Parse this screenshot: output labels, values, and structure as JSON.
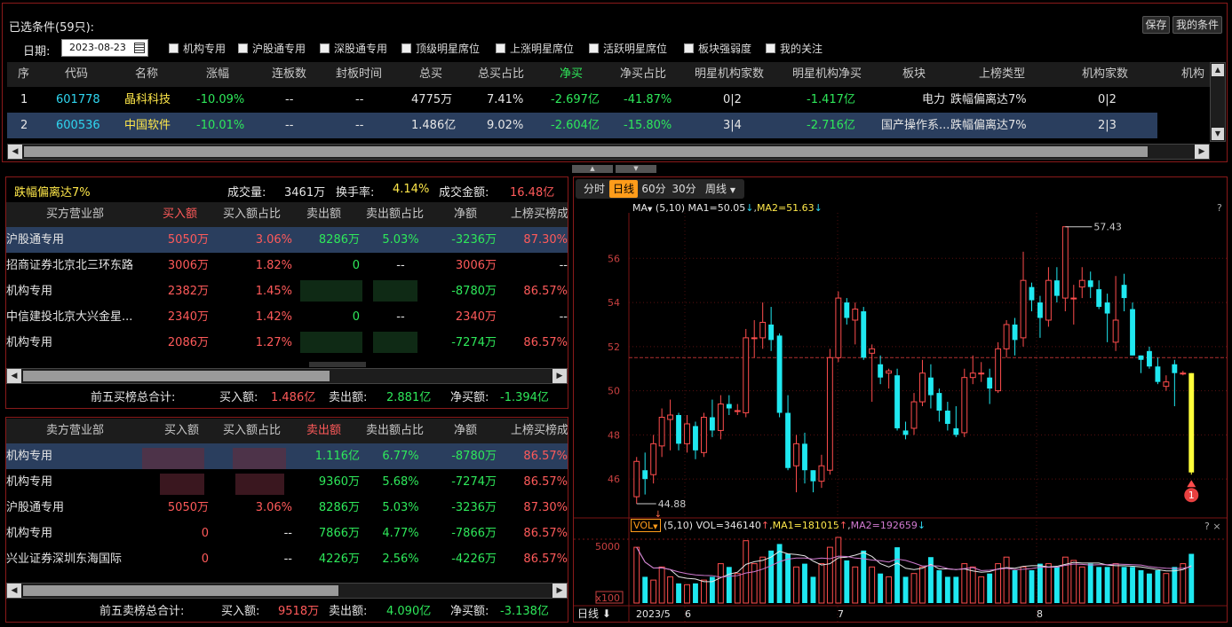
{
  "title": "已选条件(59只):",
  "buttons": {
    "save": "保存",
    "my_conditions": "我的条件"
  },
  "date_label": "日期:",
  "date_value": "2023-08-23",
  "filters": [
    "机构专用",
    "沪股通专用",
    "深股通专用",
    "顶级明星席位",
    "上涨明星席位",
    "活跃明星席位",
    "板块强弱度",
    "我的关注"
  ],
  "top_table": {
    "headers": [
      "序",
      "代码",
      "名称",
      "涨幅",
      "连板数",
      "封板时间",
      "总买",
      "总买占比",
      "净买",
      "净买占比",
      "明星机构家数",
      "明星机构净买",
      "板块",
      "上榜类型",
      "机构家数",
      "机构"
    ],
    "rows": [
      [
        "1",
        "601778",
        "晶科科技",
        "-10.09%",
        "--",
        "--",
        "4775万",
        "7.41%",
        "-2.697亿",
        "-41.87%",
        "0|2",
        "-1.417亿",
        "电力",
        "跌幅偏离达7%",
        "0|2"
      ],
      [
        "2",
        "600536",
        "中国软件",
        "-10.01%",
        "--",
        "--",
        "1.486亿",
        "9.02%",
        "-2.604亿",
        "-15.80%",
        "3|4",
        "-2.716亿",
        "国产操作系...",
        "跌幅偏离达7%",
        "2|3"
      ]
    ]
  },
  "summary": {
    "type": "跌幅偏离达7%",
    "vol_label": "成交量:",
    "vol": "3461万",
    "turn_label": "换手率:",
    "turn": "4.14%",
    "amt_label": "成交金额:",
    "amt": "16.48亿"
  },
  "buy_table": {
    "headers": [
      "买方营业部",
      "买入额",
      "买入额占比",
      "卖出额",
      "卖出额占比",
      "净额",
      "上榜买榜成"
    ],
    "rows": [
      [
        "沪股通专用",
        "5050万",
        "3.06%",
        "8286万",
        "5.03%",
        "-3236万",
        "87.30%"
      ],
      [
        "招商证券北京北三环东路",
        "3006万",
        "1.82%",
        "0",
        "--",
        "3006万",
        "--"
      ],
      [
        "机构专用",
        "2382万",
        "1.45%",
        "",
        "",
        "-8780万",
        "86.57%"
      ],
      [
        "中信建投北京大兴金星...",
        "2340万",
        "1.42%",
        "0",
        "--",
        "2340万",
        "--"
      ],
      [
        "机构专用",
        "2086万",
        "1.27%",
        "",
        "",
        "-7274万",
        "86.57%"
      ]
    ],
    "total": {
      "label": "前五买榜总合计:",
      "buy_label": "买入额:",
      "buy": "1.486亿",
      "sell_label": "卖出额:",
      "sell": "2.881亿",
      "net_label": "净买额:",
      "net": "-1.394亿"
    }
  },
  "sell_table": {
    "headers": [
      "卖方营业部",
      "买入额",
      "买入额占比",
      "卖出额",
      "卖出额占比",
      "净额",
      "上榜买榜成"
    ],
    "rows": [
      [
        "机构专用",
        "",
        "",
        "1.116亿",
        "6.77%",
        "-8780万",
        "86.57%"
      ],
      [
        "机构专用",
        "",
        "",
        "9360万",
        "5.68%",
        "-7274万",
        "86.57%"
      ],
      [
        "沪股通专用",
        "5050万",
        "3.06%",
        "8286万",
        "5.03%",
        "-3236万",
        "87.30%"
      ],
      [
        "机构专用",
        "0",
        "--",
        "7866万",
        "4.77%",
        "-7866万",
        "86.57%"
      ],
      [
        "兴业证券深圳东海国际",
        "0",
        "--",
        "4226万",
        "2.56%",
        "-4226万",
        "86.57%"
      ]
    ],
    "total": {
      "label": "前五卖榜总合计:",
      "buy_label": "买入额:",
      "buy": "9518万",
      "sell_label": "卖出额:",
      "sell": "4.090亿",
      "net_label": "净买额:",
      "net": "-3.138亿"
    }
  },
  "chart_tabs": [
    "分时",
    "日线",
    "60分",
    "30分",
    "周线"
  ],
  "ma_line": {
    "label": "MA",
    "params": "(5,10)",
    "ma1": "MA1=50.05",
    "ma2": "MA2=51.63"
  },
  "vol_line": {
    "label": "VOL",
    "params": "(5,10)",
    "vol": "VOL=346140",
    "ma1": "MA1=181015",
    "ma2": "MA2=192659"
  },
  "chart_data": {
    "type": "candlestick",
    "y_ticks": [
      46,
      48,
      50,
      52,
      54,
      56
    ],
    "ylim": [
      44.4,
      57.9
    ],
    "high_label": "57.43",
    "low_label": "44.88",
    "ref_price": 51.5,
    "x_labels": [
      "2023/5",
      "6",
      "7",
      "8"
    ],
    "vol_ticks": [
      "5000",
      "x100"
    ],
    "period_label": "日线",
    "marker": "1",
    "candles": [
      [
        45.2,
        46.8,
        44.88,
        47.0
      ],
      [
        46.4,
        46.0,
        45.3,
        47.2
      ],
      [
        46.2,
        47.6,
        45.8,
        48.0
      ],
      [
        47.5,
        48.8,
        47.0,
        49.2
      ],
      [
        48.7,
        48.9,
        47.3,
        49.6
      ],
      [
        48.9,
        47.6,
        47.3,
        49.0
      ],
      [
        47.6,
        48.5,
        47.2,
        48.9
      ],
      [
        48.4,
        47.3,
        46.9,
        48.6
      ],
      [
        47.2,
        48.8,
        47.0,
        49.0
      ],
      [
        48.8,
        48.2,
        47.9,
        49.6
      ],
      [
        48.2,
        49.4,
        47.8,
        49.8
      ],
      [
        49.4,
        49.2,
        48.9,
        49.8
      ],
      [
        49.1,
        49.1,
        48.9,
        49.4
      ],
      [
        49.0,
        52.4,
        48.8,
        52.8
      ],
      [
        52.4,
        52.4,
        51.5,
        53.2
      ],
      [
        52.4,
        53.1,
        51.9,
        54.0
      ],
      [
        53.0,
        52.3,
        51.8,
        53.8
      ],
      [
        52.5,
        49.0,
        48.8,
        52.6
      ],
      [
        49.0,
        46.5,
        46.4,
        49.8
      ],
      [
        46.6,
        47.6,
        45.4,
        48.0
      ],
      [
        47.6,
        46.4,
        45.8,
        48.1
      ],
      [
        46.4,
        45.9,
        45.4,
        46.4
      ],
      [
        45.9,
        46.6,
        45.6,
        47.1
      ],
      [
        46.4,
        51.5,
        46.2,
        51.9
      ],
      [
        51.5,
        54.2,
        51.3,
        54.5
      ],
      [
        54.0,
        53.3,
        53.0,
        54.2
      ],
      [
        53.2,
        53.7,
        52.1,
        54.0
      ],
      [
        53.6,
        51.5,
        51.4,
        53.8
      ],
      [
        51.7,
        51.9,
        49.5,
        52.1
      ],
      [
        51.2,
        50.6,
        50.3,
        51.6
      ],
      [
        50.8,
        50.9,
        50.1,
        51.0
      ],
      [
        50.7,
        48.3,
        48.2,
        51.0
      ],
      [
        48.2,
        48.0,
        47.8,
        48.6
      ],
      [
        48.3,
        49.5,
        48.0,
        49.9
      ],
      [
        49.5,
        50.8,
        49.3,
        51.4
      ],
      [
        50.6,
        49.8,
        49.2,
        51.2
      ],
      [
        49.9,
        49.1,
        48.6,
        50.1
      ],
      [
        49.1,
        48.5,
        48.2,
        49.5
      ],
      [
        48.3,
        48.0,
        47.9,
        49.3
      ],
      [
        48.1,
        50.6,
        47.9,
        51.0
      ],
      [
        50.6,
        50.8,
        50.3,
        51.6
      ],
      [
        50.8,
        50.8,
        50.4,
        51.3
      ],
      [
        50.6,
        50.1,
        49.4,
        51.0
      ],
      [
        50.0,
        51.9,
        49.9,
        52.2
      ],
      [
        51.9,
        53.0,
        51.5,
        53.2
      ],
      [
        53.0,
        52.3,
        51.6,
        53.3
      ],
      [
        52.4,
        55.0,
        52.0,
        56.3
      ],
      [
        54.7,
        54.1,
        53.6,
        54.9
      ],
      [
        54.0,
        53.3,
        52.4,
        54.3
      ],
      [
        53.2,
        55.0,
        52.9,
        55.6
      ],
      [
        55.0,
        54.3,
        54.0,
        55.6
      ],
      [
        54.2,
        57.43,
        53.6,
        57.43
      ],
      [
        54.2,
        54.2,
        53.0,
        54.8
      ],
      [
        54.7,
        55.0,
        54.2,
        55.6
      ],
      [
        55.0,
        54.7,
        54.2,
        55.4
      ],
      [
        54.6,
        53.8,
        53.7,
        55.0
      ],
      [
        54.0,
        53.5,
        52.2,
        54.4
      ],
      [
        52.2,
        53.2,
        51.8,
        55.2
      ],
      [
        54.8,
        54.2,
        53.6,
        55.3
      ],
      [
        53.7,
        51.6,
        51.6,
        54.0
      ],
      [
        51.6,
        51.4,
        50.8,
        51.6
      ],
      [
        51.8,
        51.1,
        51.0,
        52.0
      ],
      [
        51.1,
        50.4,
        50.3,
        51.5
      ],
      [
        50.2,
        50.4,
        50.0,
        50.7
      ],
      [
        51.2,
        50.8,
        49.3,
        51.4
      ],
      [
        50.8,
        50.8,
        50.7,
        50.9
      ],
      [
        50.8,
        46.3,
        46.2,
        50.8
      ]
    ],
    "volume": [
      85,
      40,
      35,
      55,
      40,
      30,
      28,
      30,
      35,
      40,
      60,
      55,
      45,
      95,
      60,
      70,
      80,
      90,
      75,
      55,
      60,
      40,
      60,
      85,
      100,
      65,
      55,
      80,
      55,
      45,
      40,
      85,
      40,
      45,
      55,
      70,
      50,
      40,
      40,
      60,
      55,
      40,
      45,
      60,
      70,
      50,
      55,
      50,
      60,
      60,
      55,
      70,
      65,
      55,
      60,
      55,
      55,
      60,
      55,
      55,
      50,
      45,
      50,
      45,
      55,
      60,
      75
    ]
  }
}
